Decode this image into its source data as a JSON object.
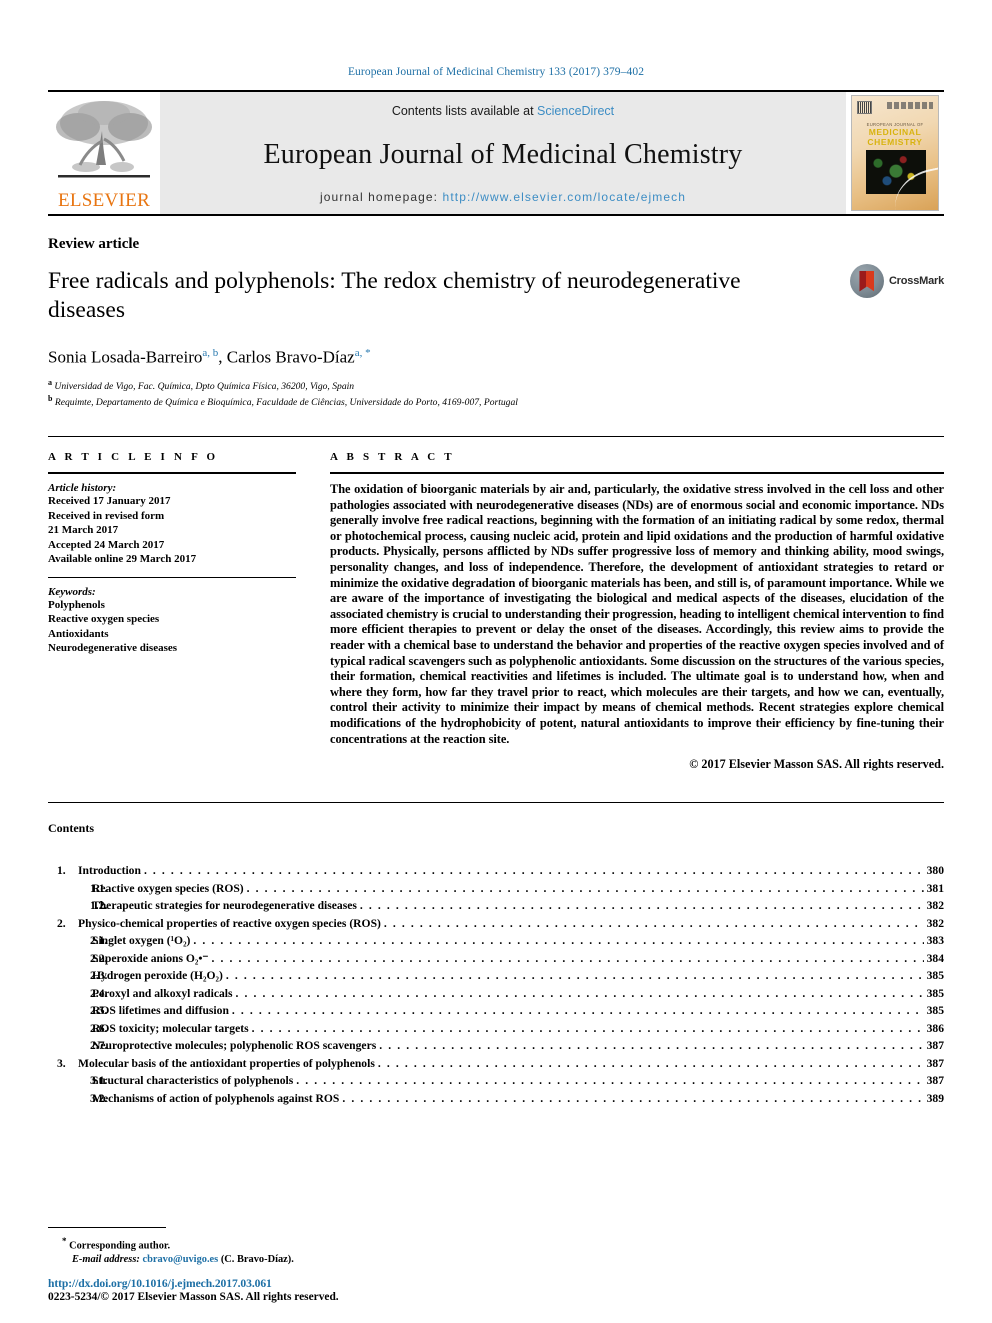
{
  "running_head": "European Journal of Medicinal Chemistry 133 (2017) 379–402",
  "masthead": {
    "publisher_name": "ELSEVIER",
    "contents_prefix": "Contents lists available at ",
    "sciencedirect": "ScienceDirect",
    "journal_name": "European Journal of Medicinal Chemistry",
    "homepage_prefix": "journal homepage: ",
    "homepage_url": "http://www.elsevier.com/locate/ejmech",
    "cover": {
      "line1": "EUROPEAN JOURNAL OF",
      "line2": "MEDICINAL",
      "line3": "CHEMISTRY"
    }
  },
  "article": {
    "kicker": "Review article",
    "title": "Free radicals and polyphenols: The redox chemistry of neurodegenerative diseases",
    "author1": "Sonia Losada-Barreiro",
    "author1_marks": "a, b",
    "author_sep": ", ",
    "author2": "Carlos Bravo-Díaz",
    "author2_marks": "a, *",
    "affiliations": [
      {
        "mark": "a",
        "text": "Universidad de Vigo, Fac. Química, Dpto Química Física, 36200, Vigo, Spain"
      },
      {
        "mark": "b",
        "text": "Requimte, Departamento de Química e Bioquímica, Faculdade de Ciências, Universidade do Porto, 4169-007, Portugal"
      }
    ],
    "crossmark_label": "CrossMark"
  },
  "article_info": {
    "heading": "A R T I C L E    I N F O",
    "history_label": "Article history:",
    "history": [
      "Received 17 January 2017",
      "Received in revised form",
      "21 March 2017",
      "Accepted 24 March 2017",
      "Available online 29 March 2017"
    ],
    "keywords_label": "Keywords:",
    "keywords": [
      "Polyphenols",
      "Reactive oxygen species",
      "Antioxidants",
      "Neurodegenerative diseases"
    ]
  },
  "abstract": {
    "heading": "A B S T R A C T",
    "text": "The oxidation of bioorganic materials by air and, particularly, the oxidative stress involved in the cell loss and other pathologies associated with neurodegenerative diseases (NDs) are of enormous social and economic importance. NDs generally involve free radical reactions, beginning with the formation of an initiating radical by some redox, thermal or photochemical process, causing nucleic acid, protein and lipid oxidations and the production of harmful oxidative products. Physically, persons afflicted by NDs suffer progressive loss of memory and thinking ability, mood swings, personality changes, and loss of independence. Therefore, the development of antioxidant strategies to retard or minimize the oxidative degradation of bioorganic materials has been, and still is, of paramount importance. While we are aware of the importance of investigating the biological and medical aspects of the diseases, elucidation of the associated chemistry is crucial to understanding their progression, heading to intelligent chemical intervention to find more efficient therapies to prevent or delay the onset of the diseases. Accordingly, this review aims to provide the reader with a chemical base to understand the behavior and properties of the reactive oxygen species involved and of typical radical scavengers such as polyphenolic antioxidants. Some discussion on the structures of the various species, their formation, chemical reactivities and lifetimes is included. The ultimate goal is to understand how, when and where they form, how far they travel prior to react, which molecules are their targets, and how we can, eventually, control their activity to minimize their impact by means of chemical methods. Recent strategies explore chemical modifications of the hydrophobicity of potent, natural antioxidants to improve their efficiency by fine-tuning their concentrations at the reaction site.",
    "copyright": "© 2017 Elsevier Masson SAS. All rights reserved."
  },
  "contents": {
    "title": "Contents",
    "entries": [
      {
        "level": 1,
        "num": "1.",
        "text": "Introduction",
        "page": "380"
      },
      {
        "level": 2,
        "num": "1.1.",
        "text": "Reactive oxygen species (ROS)",
        "page": "381"
      },
      {
        "level": 2,
        "num": "1.2.",
        "text": "Therapeutic strategies for neurodegenerative diseases",
        "page": "382"
      },
      {
        "level": 1,
        "num": "2.",
        "text": "Physico-chemical properties of reactive oxygen species (ROS)",
        "page": "382"
      },
      {
        "level": 2,
        "num": "2.1.",
        "text": "Singlet oxygen (¹O₂)",
        "page": "383"
      },
      {
        "level": 2,
        "num": "2.2.",
        "text": "Superoxide anions O₂•⁻",
        "page": "384"
      },
      {
        "level": 2,
        "num": "2.3.",
        "text": "Hydrogen peroxide (H₂O₂)",
        "page": "385"
      },
      {
        "level": 2,
        "num": "2.4.",
        "text": "Peroxyl and alkoxyl radicals",
        "page": "385"
      },
      {
        "level": 2,
        "num": "2.5.",
        "text": "ROS lifetimes and diffusion",
        "page": "385"
      },
      {
        "level": 2,
        "num": "2.6.",
        "text": "ROS toxicity; molecular targets",
        "page": "386"
      },
      {
        "level": 2,
        "num": "2.7.",
        "text": "Neuroprotective molecules; polyphenolic ROS scavengers",
        "page": "387"
      },
      {
        "level": 1,
        "num": "3.",
        "text": "Molecular basis of the antioxidant properties of polyphenols",
        "page": "387"
      },
      {
        "level": 2,
        "num": "3.1.",
        "text": "Structural characteristics of polyphenols",
        "page": "387"
      },
      {
        "level": 2,
        "num": "3.2.",
        "text": "Mechanisms of action of polyphenols against ROS",
        "page": "389"
      }
    ],
    "dot_fill": ". . . . . . . . . . . . . . . . . . . . . . . . . . . . . . . . . . . . . . . . . . . . . . . . . . . . . . . . . . . . . . . . . . . . . . . . . . . . . . . . . . . . . . . . . . . . . . . . . . . . . . . . . . . . . . . . . . . . . . . . . . . . . . . . . . . . . . . . . . . . . . . . . . . . . . . . . . . . . . . . . . . . . . . . . . . . . . . . . . . . . . . . . . . . . . . . . . . . . . . . . . . . . . . . . . . . . . . . . . . ."
  },
  "footnotes": {
    "corresponding_mark": "*",
    "corresponding_text": "Corresponding author.",
    "email_label": "E-mail address:",
    "email": "cbravo@uvigo.es",
    "email_owner": "(C. Bravo-Díaz).",
    "doi": "http://dx.doi.org/10.1016/j.ejmech.2017.03.061",
    "issn_line": "0223-5234/© 2017 Elsevier Masson SAS. All rights reserved."
  }
}
